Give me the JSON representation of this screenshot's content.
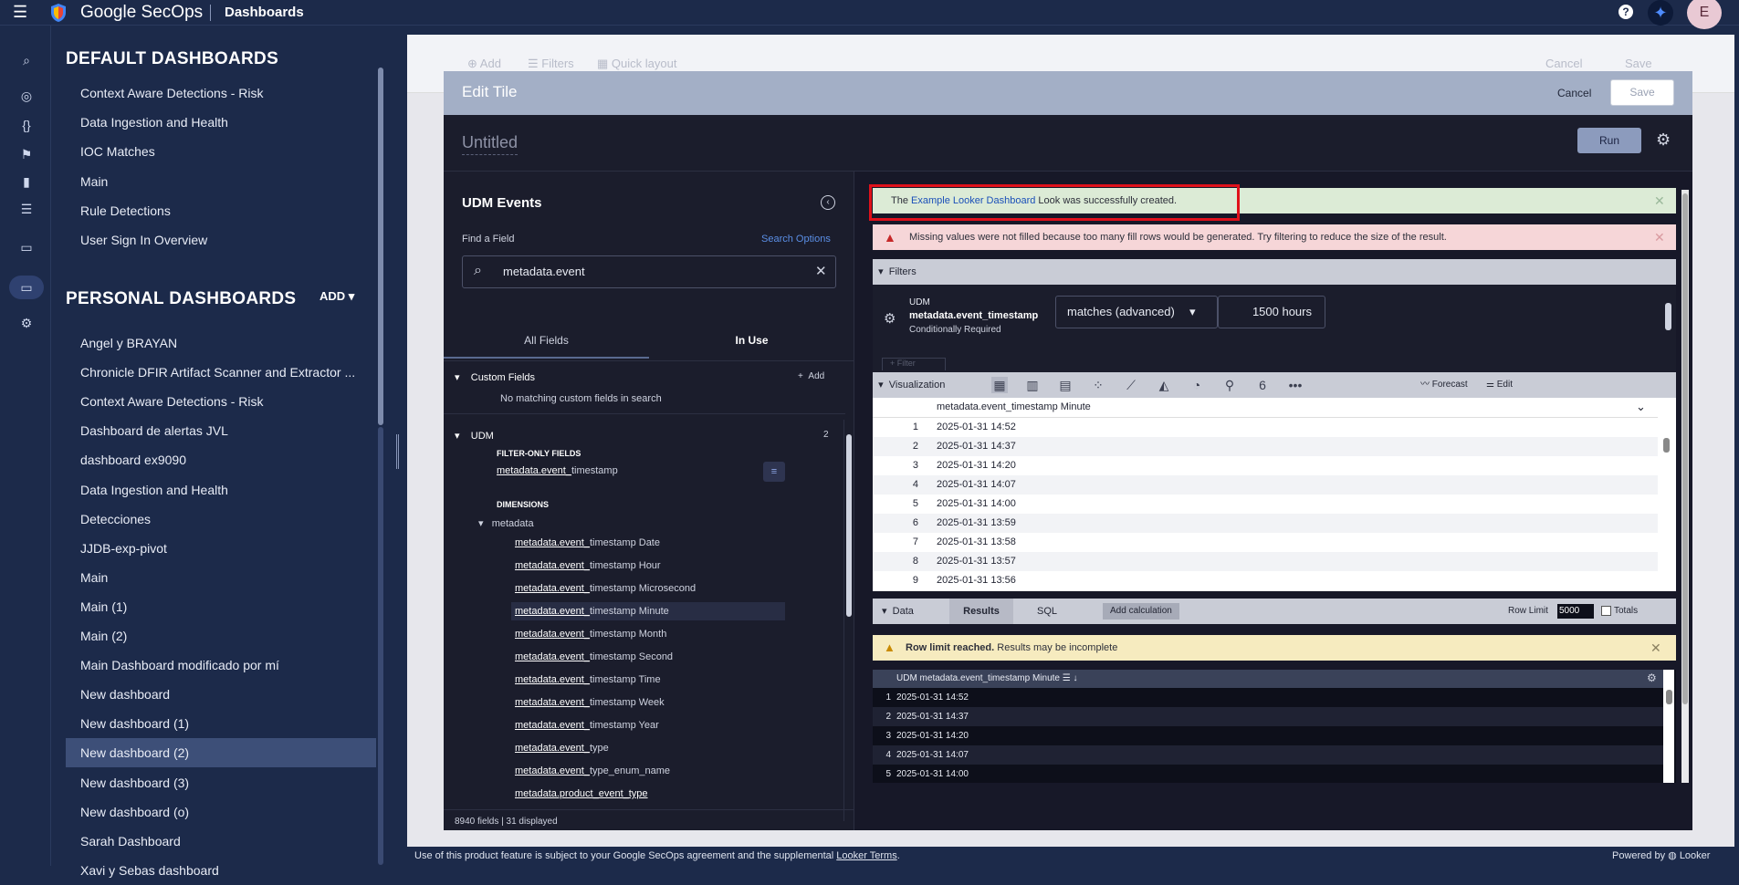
{
  "topbar": {
    "brand": "Google SecOps",
    "crumb": "Dashboards",
    "help": "?",
    "avatar": "E"
  },
  "sidebar": {
    "default_header": "DEFAULT DASHBOARDS",
    "default_items": [
      "Context Aware Detections - Risk",
      "Data Ingestion and Health",
      "IOC Matches",
      "Main",
      "Rule Detections",
      "User Sign In Overview"
    ],
    "personal_header": "PERSONAL DASHBOARDS",
    "add_label": "ADD",
    "personal_items": [
      "Angel y BRAYAN",
      "Chronicle DFIR Artifact Scanner and Extractor ...",
      "Context Aware Detections - Risk",
      "Dashboard de alertas JVL",
      "dashboard ex9090",
      "Data Ingestion and Health",
      "Detecciones",
      "JJDB-exp-pivot",
      "Main",
      "Main (1)",
      "Main (2)",
      "Main Dashboard modificado por mí",
      "New dashboard",
      "New dashboard (1)",
      "New dashboard (2)",
      "New dashboard (3)",
      "New dashboard (o)",
      "Sarah Dashboard",
      "Xavi y Sebas dashboard"
    ],
    "selected_index": 14
  },
  "background": {
    "add": "Add",
    "filters": "Filters",
    "quick_layout": "Quick layout",
    "cancel": "Cancel",
    "save": "Save"
  },
  "modal": {
    "title": "Edit Tile",
    "cancel": "Cancel",
    "save": "Save",
    "tile_name": "Untitled",
    "run": "Run"
  },
  "field_picker": {
    "title": "UDM Events",
    "find_label": "Find a Field",
    "search_options": "Search Options",
    "search_value": "metadata.event",
    "tab_all": "All Fields",
    "tab_in_use": "In Use",
    "custom_fields": "Custom Fields",
    "custom_add": "Add",
    "no_custom": "No matching custom fields in search",
    "udm_group": "UDM",
    "udm_count": "2",
    "filter_only": "FILTER-ONLY FIELDS",
    "filter_field_prefix": "metadata.event_",
    "filter_field_suffix": "timestamp",
    "dimensions": "DIMENSIONS",
    "metadata_group": "metadata",
    "dimension_fields": [
      {
        "prefix": "metadata.event_",
        "suffix": "timestamp Date"
      },
      {
        "prefix": "metadata.event_",
        "suffix": "timestamp Hour"
      },
      {
        "prefix": "metadata.event_",
        "suffix": "timestamp Microsecond"
      },
      {
        "prefix": "metadata.event_",
        "suffix": "timestamp Minute"
      },
      {
        "prefix": "metadata.event_",
        "suffix": "timestamp Month"
      },
      {
        "prefix": "metadata.event_",
        "suffix": "timestamp Second"
      },
      {
        "prefix": "metadata.event_",
        "suffix": "timestamp Time"
      },
      {
        "prefix": "metadata.event_",
        "suffix": "timestamp Week"
      },
      {
        "prefix": "metadata.event_",
        "suffix": "timestamp Year"
      },
      {
        "prefix": "metadata.event_",
        "suffix": "type"
      },
      {
        "prefix": "metadata.event_",
        "suffix": "type_enum_name"
      },
      {
        "prefix": "metadata.product_event_type",
        "suffix": ""
      }
    ],
    "highlighted_index": 3,
    "footer": "8940 fields | 31 displayed"
  },
  "banners": {
    "success_pre": "The ",
    "success_link": "Example Looker Dashboard",
    "success_post": " Look was successfully created.",
    "warning": "Missing values were not filled because too many fill rows would be generated. Try filtering to reduce the size of the result.",
    "row_limit_bold": "Row limit reached.",
    "row_limit_rest": " Results may be incomplete"
  },
  "filters": {
    "section": "Filters",
    "udm": "UDM",
    "field": "metadata.event_timestamp",
    "required": "Conditionally Required",
    "operator": "matches (advanced)",
    "value": "1500 hours",
    "add_filter": "+ Filter"
  },
  "visualization": {
    "section": "Visualization",
    "forecast": "Forecast",
    "edit": "Edit",
    "column_header": "metadata.event_timestamp Minute",
    "rows": [
      "2025-01-31 14:52",
      "2025-01-31 14:37",
      "2025-01-31 14:20",
      "2025-01-31 14:07",
      "2025-01-31 14:00",
      "2025-01-31 13:59",
      "2025-01-31 13:58",
      "2025-01-31 13:57",
      "2025-01-31 13:56"
    ],
    "icons": [
      "table-icon",
      "bar-chart-icon",
      "column-chart-icon",
      "scatter-icon",
      "line-chart-icon",
      "area-chart-icon",
      "pie-chart-icon",
      "map-pin-icon",
      "single-value-icon",
      "more-icon"
    ]
  },
  "data": {
    "section": "Data",
    "tab_results": "Results",
    "tab_sql": "SQL",
    "add_calc": "Add calculation",
    "row_limit_label": "Row Limit",
    "row_limit_value": "5000",
    "totals": "Totals",
    "header": "UDM metadata.event_timestamp Minute",
    "rows": [
      "2025-01-31 14:52",
      "2025-01-31 14:37",
      "2025-01-31 14:20",
      "2025-01-31 14:07",
      "2025-01-31 14:00"
    ]
  },
  "footer": {
    "text": "Use of this product feature is subject to your Google SecOps agreement and the supplemental ",
    "link": "Looker Terms",
    "end": ".",
    "powered": "Powered by",
    "looker": "Looker"
  },
  "colors": {
    "nav_bg": "#1c2a4a",
    "success_bg": "#dcebd6",
    "error_bg": "#f6d6d8",
    "warn_bg": "#f6ebbf",
    "highlight": "#e0111b"
  }
}
